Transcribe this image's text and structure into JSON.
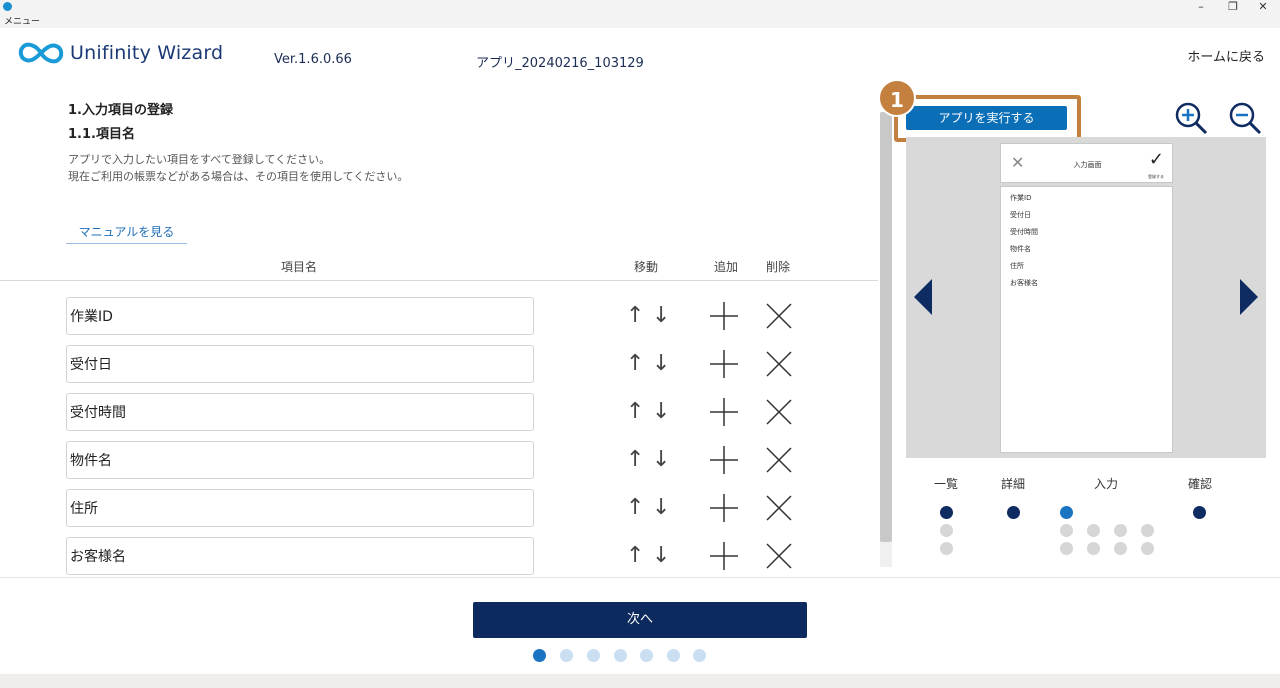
{
  "window": {
    "title": "メニュー",
    "min_label": "–",
    "max_label": "❐",
    "close_label": "✕"
  },
  "header": {
    "brand": "Unifinity Wizard",
    "version": "Ver.1.6.0.66",
    "app_name": "アプリ_20240216_103129",
    "home_link": "ホームに戻る"
  },
  "content": {
    "step_title": "1.入力項目の登録",
    "sub_title": "1.1.項目名",
    "desc_line1": "アプリで入力したい項目をすべて登録してください。",
    "desc_line2": "現在ご利用の帳票などがある場合は、その項目を使用してください。",
    "manual_link": "マニュアルを見る",
    "columns": {
      "name": "項目名",
      "move": "移動",
      "add": "追加",
      "delete": "削除"
    },
    "rows": [
      {
        "value": "作業ID"
      },
      {
        "value": "受付日"
      },
      {
        "value": "受付時間"
      },
      {
        "value": "物件名"
      },
      {
        "value": "住所"
      },
      {
        "value": "お客様名"
      }
    ],
    "arrow_up": "↑",
    "arrow_down": "↓"
  },
  "preview": {
    "badge": "1",
    "run_button": "アプリを実行する",
    "phone_title": "入力画面",
    "phone_close": "✕",
    "phone_check": "✓",
    "phone_check_label": "登録する",
    "phone_items": [
      "作業ID",
      "受付日",
      "受付時間",
      "物件名",
      "住所",
      "お客様名"
    ],
    "tabs": [
      "一覧",
      "詳細",
      "入力",
      "確認"
    ]
  },
  "footer": {
    "next_button": "次へ",
    "steps_total": 7,
    "current_step": 1
  },
  "colors": {
    "brand": "#1b3a75",
    "accent_blue": "#0b6fb8",
    "highlight": "#c4803f",
    "dark_navy": "#0d2a5f"
  }
}
